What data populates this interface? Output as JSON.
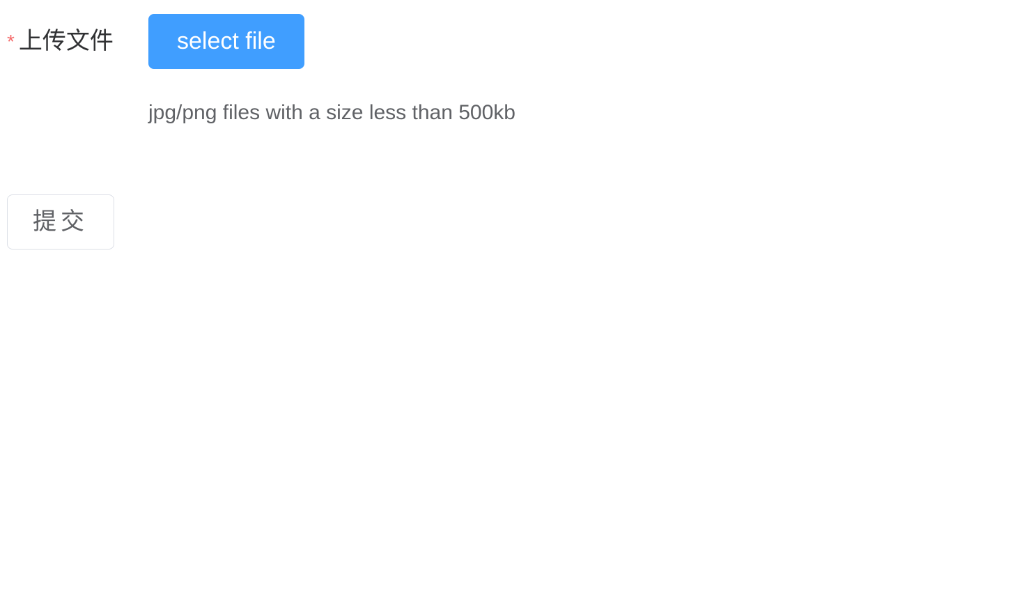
{
  "form": {
    "upload": {
      "required_mark": "*",
      "label": "上传文件",
      "button_label": "select file",
      "tip": "jpg/png files with a size less than 500kb"
    },
    "submit_label": "提交"
  }
}
